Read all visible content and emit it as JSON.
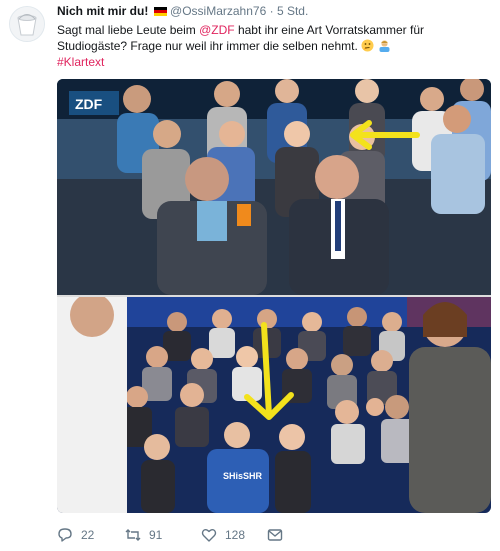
{
  "author": {
    "display_name": "Nich mit mir du!",
    "handle": "@OssiMarzahn76",
    "separator": "·",
    "time": "5 Std."
  },
  "text": {
    "part1": "Sagt mal liebe Leute beim ",
    "mention": "@ZDF",
    "part2": " habt ihr eine Art Vorratskammer für Studiogäste? Frage nur weil ihr immer die selben nehmt.",
    "hashtag": "#Klartext"
  },
  "photos": [
    {
      "name": "studio-audience-photo-top",
      "logo_text": "ZDF",
      "arrow_color": "#f3e21c"
    },
    {
      "name": "studio-audience-photo-bottom",
      "shirt_text": "SHisSHR",
      "arrow_color": "#f3e21c"
    }
  ],
  "actions": {
    "reply_count": "22",
    "retweet_count": "91",
    "like_count": "128"
  },
  "colors": {
    "accent": "#e0245e",
    "muted": "#657786",
    "arrow": "#f3e21c"
  }
}
